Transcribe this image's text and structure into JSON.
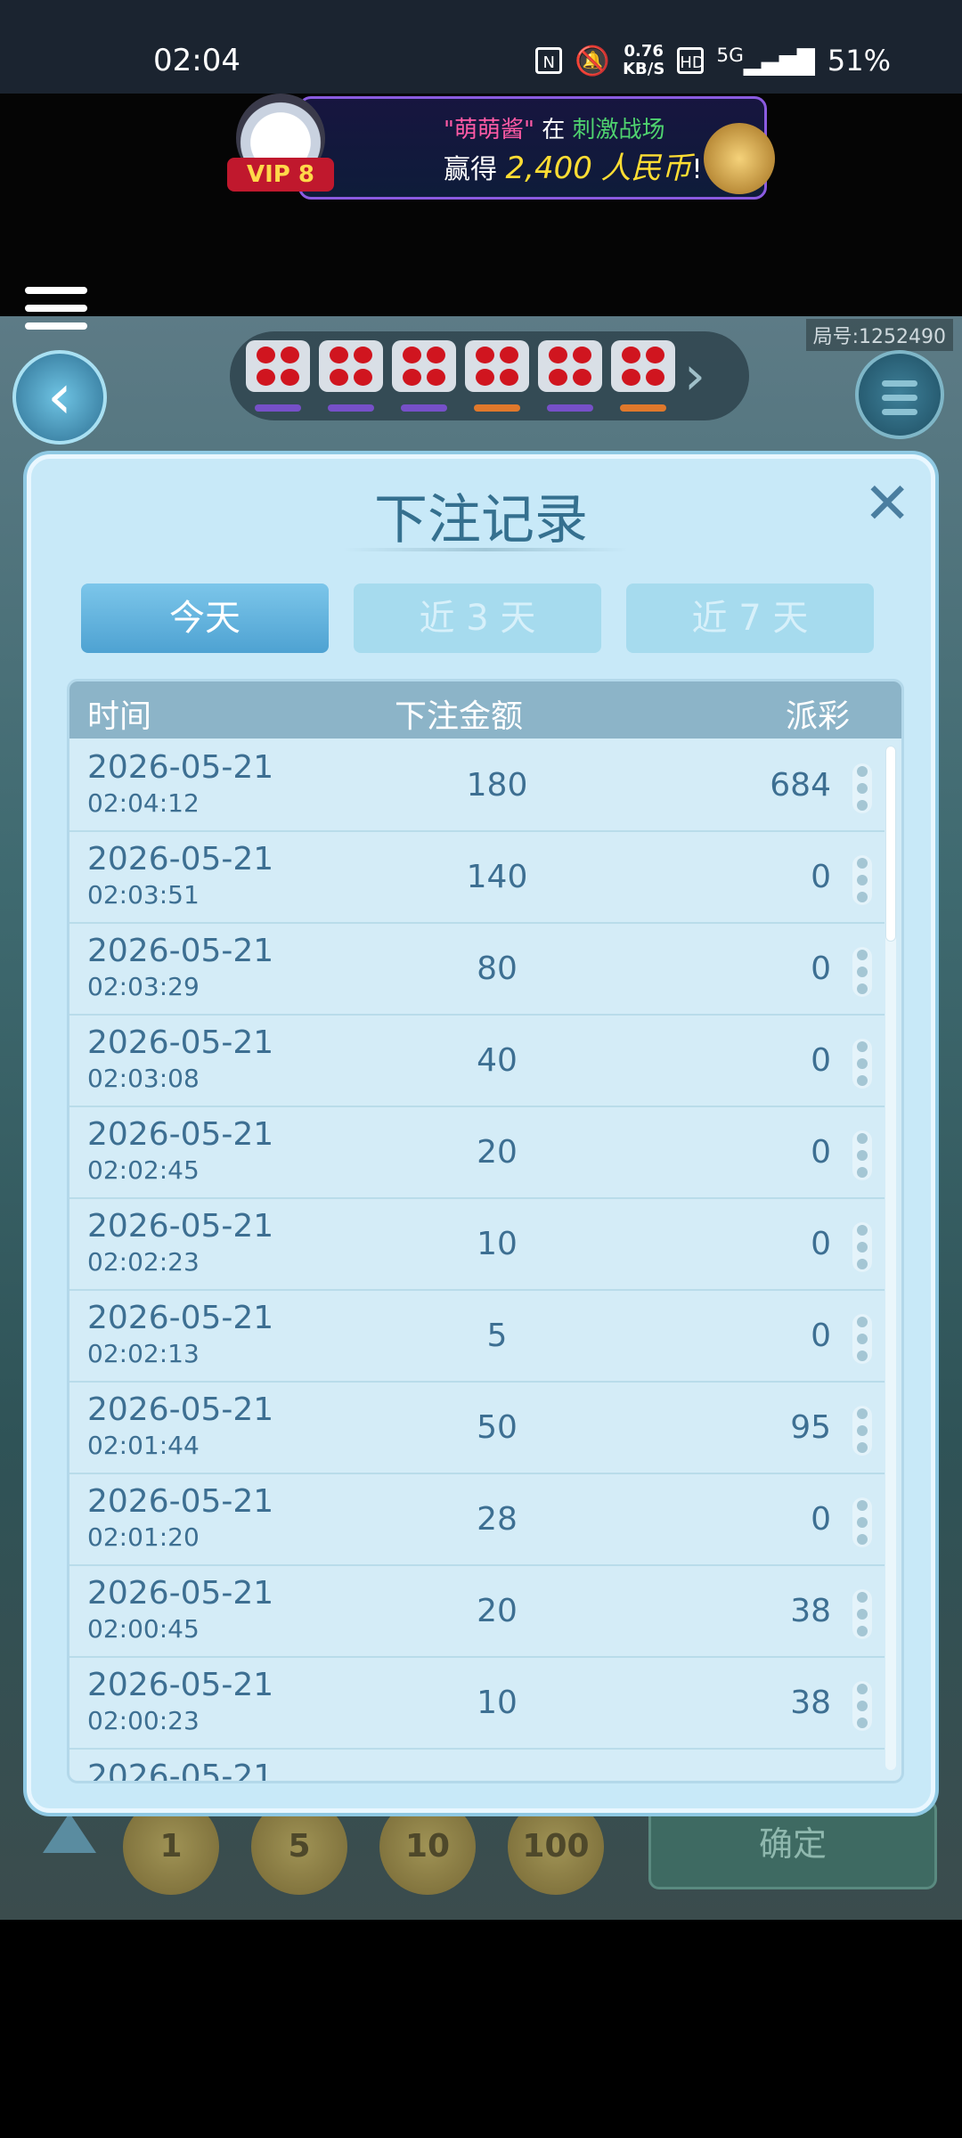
{
  "status_bar": {
    "time": "02:04",
    "net_speed": "0.76\nKB/S",
    "hd": "HD",
    "network": "5G",
    "battery": "51%"
  },
  "banner": {
    "vip_label": "VIP 8",
    "player": "\"萌萌酱\"",
    "in": "在",
    "game": "刺激战场",
    "won": "赢得",
    "amount": "2,400",
    "currency": "人民币",
    "suffix": "!"
  },
  "game": {
    "round_number": "局号:1252490",
    "confirm_label": "确定",
    "coins": [
      "1",
      "5",
      "10",
      "100"
    ]
  },
  "dice_history": [
    {
      "color": "#7650c8"
    },
    {
      "color": "#7650c8"
    },
    {
      "color": "#7650c8"
    },
    {
      "color": "#e0782b"
    },
    {
      "color": "#7650c8"
    },
    {
      "color": "#e0782b"
    }
  ],
  "dialog": {
    "title": "下注记录",
    "tabs": [
      {
        "label": "今天",
        "active": true
      },
      {
        "label": "近 3 天",
        "active": false
      },
      {
        "label": "近 7 天",
        "active": false
      }
    ],
    "columns": {
      "time": "时间",
      "bet": "下注金额",
      "payout": "派彩"
    },
    "rows": [
      {
        "date": "2026-05-21",
        "time": "02:04:12",
        "bet": "180",
        "payout": "684"
      },
      {
        "date": "2026-05-21",
        "time": "02:03:51",
        "bet": "140",
        "payout": "0"
      },
      {
        "date": "2026-05-21",
        "time": "02:03:29",
        "bet": "80",
        "payout": "0"
      },
      {
        "date": "2026-05-21",
        "time": "02:03:08",
        "bet": "40",
        "payout": "0"
      },
      {
        "date": "2026-05-21",
        "time": "02:02:45",
        "bet": "20",
        "payout": "0"
      },
      {
        "date": "2026-05-21",
        "time": "02:02:23",
        "bet": "10",
        "payout": "0"
      },
      {
        "date": "2026-05-21",
        "time": "02:02:13",
        "bet": "5",
        "payout": "0"
      },
      {
        "date": "2026-05-21",
        "time": "02:01:44",
        "bet": "50",
        "payout": "95"
      },
      {
        "date": "2026-05-21",
        "time": "02:01:20",
        "bet": "28",
        "payout": "0"
      },
      {
        "date": "2026-05-21",
        "time": "02:00:45",
        "bet": "20",
        "payout": "38"
      },
      {
        "date": "2026-05-21",
        "time": "02:00:23",
        "bet": "10",
        "payout": "38"
      }
    ],
    "partial_row_date": "2026-05-21"
  }
}
